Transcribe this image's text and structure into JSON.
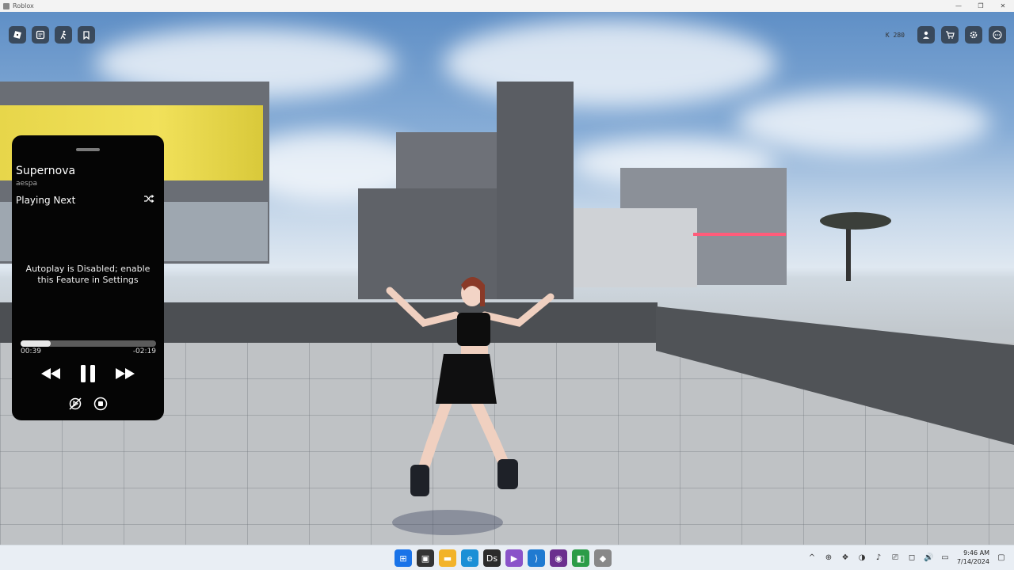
{
  "window": {
    "title": "Roblox",
    "controls": [
      "—",
      "❐",
      "✕"
    ]
  },
  "game_topbar": {
    "left_icons": [
      "roblox-menu-icon",
      "chat-icon",
      "emote-icon",
      "backpack-icon"
    ],
    "stats_text": "K 280",
    "right_icons": [
      "avatar-icon",
      "shop-icon",
      "settings-icon",
      "more-icon"
    ]
  },
  "player": {
    "song_title": "Supernova",
    "artist": "aespa",
    "playing_next_label": "Playing Next",
    "autoplay_message": "Autoplay is Disabled; enable this Feature in Settings",
    "elapsed": "00:39",
    "remaining": "-02:19",
    "progress_fraction": 0.22
  },
  "taskbar": {
    "apps": [
      {
        "name": "windows-start-icon",
        "glyph": "⊞",
        "color": "#1a73e8"
      },
      {
        "name": "task-view-icon",
        "glyph": "▣",
        "color": "#333333"
      },
      {
        "name": "file-explorer-icon",
        "glyph": "▬",
        "color": "#f2b32a"
      },
      {
        "name": "edge-icon",
        "glyph": "e",
        "color": "#1b8fd6"
      },
      {
        "name": "davinci-icon",
        "glyph": "Ds",
        "color": "#2b2b2b"
      },
      {
        "name": "visual-studio-icon",
        "glyph": "▶",
        "color": "#8a53c9"
      },
      {
        "name": "vscode-icon",
        "glyph": "⟩",
        "color": "#1f7ad1"
      },
      {
        "name": "obs-icon",
        "glyph": "◉",
        "color": "#6b2f8e"
      },
      {
        "name": "camera-app-icon",
        "glyph": "◧",
        "color": "#2c9c48"
      },
      {
        "name": "roblox-taskbar-icon",
        "glyph": "◆",
        "color": "#888888"
      }
    ],
    "tray_icons": [
      "^",
      "⊕",
      "❖",
      "◑",
      "♪",
      "⎚",
      "◻",
      "🔊",
      "▭"
    ],
    "time": "9:46 AM",
    "date": "7/14/2024"
  }
}
